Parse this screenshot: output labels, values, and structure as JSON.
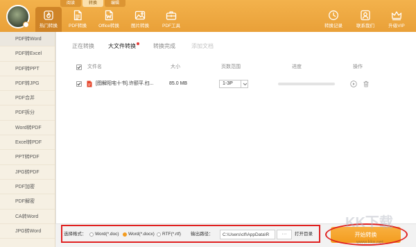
{
  "colors": {
    "accent": "#efa83d",
    "accent_dark": "#cf8427",
    "start_button": "#f39c1f",
    "annotation_red": "#e0201f",
    "badge_dot": "#e53935",
    "radio_selected": "#f39c1f"
  },
  "top_tabs": [
    {
      "label": "阅读",
      "active": false
    },
    {
      "label": "转换",
      "active": true
    },
    {
      "label": "编辑",
      "active": false
    }
  ],
  "toolbar": {
    "left": [
      {
        "label": "热门转换",
        "icon": "hot-convert-icon",
        "active": true
      },
      {
        "label": "PDF转换",
        "icon": "pdf-document-icon",
        "active": false
      },
      {
        "label": "Office转换",
        "icon": "office-document-icon",
        "active": false
      },
      {
        "label": "图片转换",
        "icon": "image-icon",
        "active": false
      },
      {
        "label": "PDF工具",
        "icon": "toolbox-icon",
        "active": false
      }
    ],
    "right": [
      {
        "label": "转换记录",
        "icon": "clock-icon"
      },
      {
        "label": "联系我们",
        "icon": "contact-icon"
      },
      {
        "label": "升级VIP",
        "icon": "crown-icon"
      }
    ]
  },
  "sidebar": {
    "items": [
      {
        "label": "PDF转Word",
        "selected": true
      },
      {
        "label": "PDF转Excel",
        "selected": false
      },
      {
        "label": "PDF转PPT",
        "selected": false
      },
      {
        "label": "PDF转JPG",
        "selected": false
      },
      {
        "label": "PDF合并",
        "selected": false
      },
      {
        "label": "PDF拆分",
        "selected": false
      },
      {
        "label": "Word转PDF",
        "selected": false
      },
      {
        "label": "Excel转PDF",
        "selected": false
      },
      {
        "label": "PPT转PDF",
        "selected": false
      },
      {
        "label": "JPG转PDF",
        "selected": false
      },
      {
        "label": "PDF加密",
        "selected": false
      },
      {
        "label": "PDF解密",
        "selected": false
      },
      {
        "label": "CA转Word",
        "selected": false
      },
      {
        "label": "JPG转Word",
        "selected": false
      }
    ]
  },
  "main": {
    "tabs": [
      {
        "label": "正在转换",
        "active": false,
        "disabled": false
      },
      {
        "label": "大文件转换",
        "active": true,
        "disabled": false,
        "badge_dot": true
      },
      {
        "label": "转换完成",
        "active": false,
        "disabled": false
      },
      {
        "label": "添加文档",
        "active": false,
        "disabled": true
      }
    ],
    "table": {
      "select_all_checked": true,
      "headers": {
        "file_name": "文件名",
        "size": "大小",
        "page_range": "页数范围",
        "progress": "进度",
        "actions": "操作"
      },
      "rows": [
        {
          "checked": true,
          "file_type_icon": "pdf-file-icon",
          "file_name": "[图解阳宅十书].许颐平.扫...",
          "size": "85.0 MB",
          "page_range": "1-3P",
          "progress": 0,
          "actions": [
            "play-icon",
            "trash-icon"
          ]
        }
      ]
    }
  },
  "bottom": {
    "format_label": "选择格式：",
    "formats": [
      {
        "label": "Word(*.doc)",
        "selected": false
      },
      {
        "label": "Word(*.docx)",
        "selected": true
      },
      {
        "label": "RTF(*.rtf)",
        "selected": false
      }
    ],
    "output_label": "输出路径：",
    "output_path": "C:\\Users\\clf\\AppData\\R",
    "browse_label": "···",
    "open_dir_label": "打开目录",
    "start_label": "开始转换"
  },
  "watermark": {
    "brand": "KK下载",
    "url": "www.kkx.net"
  }
}
